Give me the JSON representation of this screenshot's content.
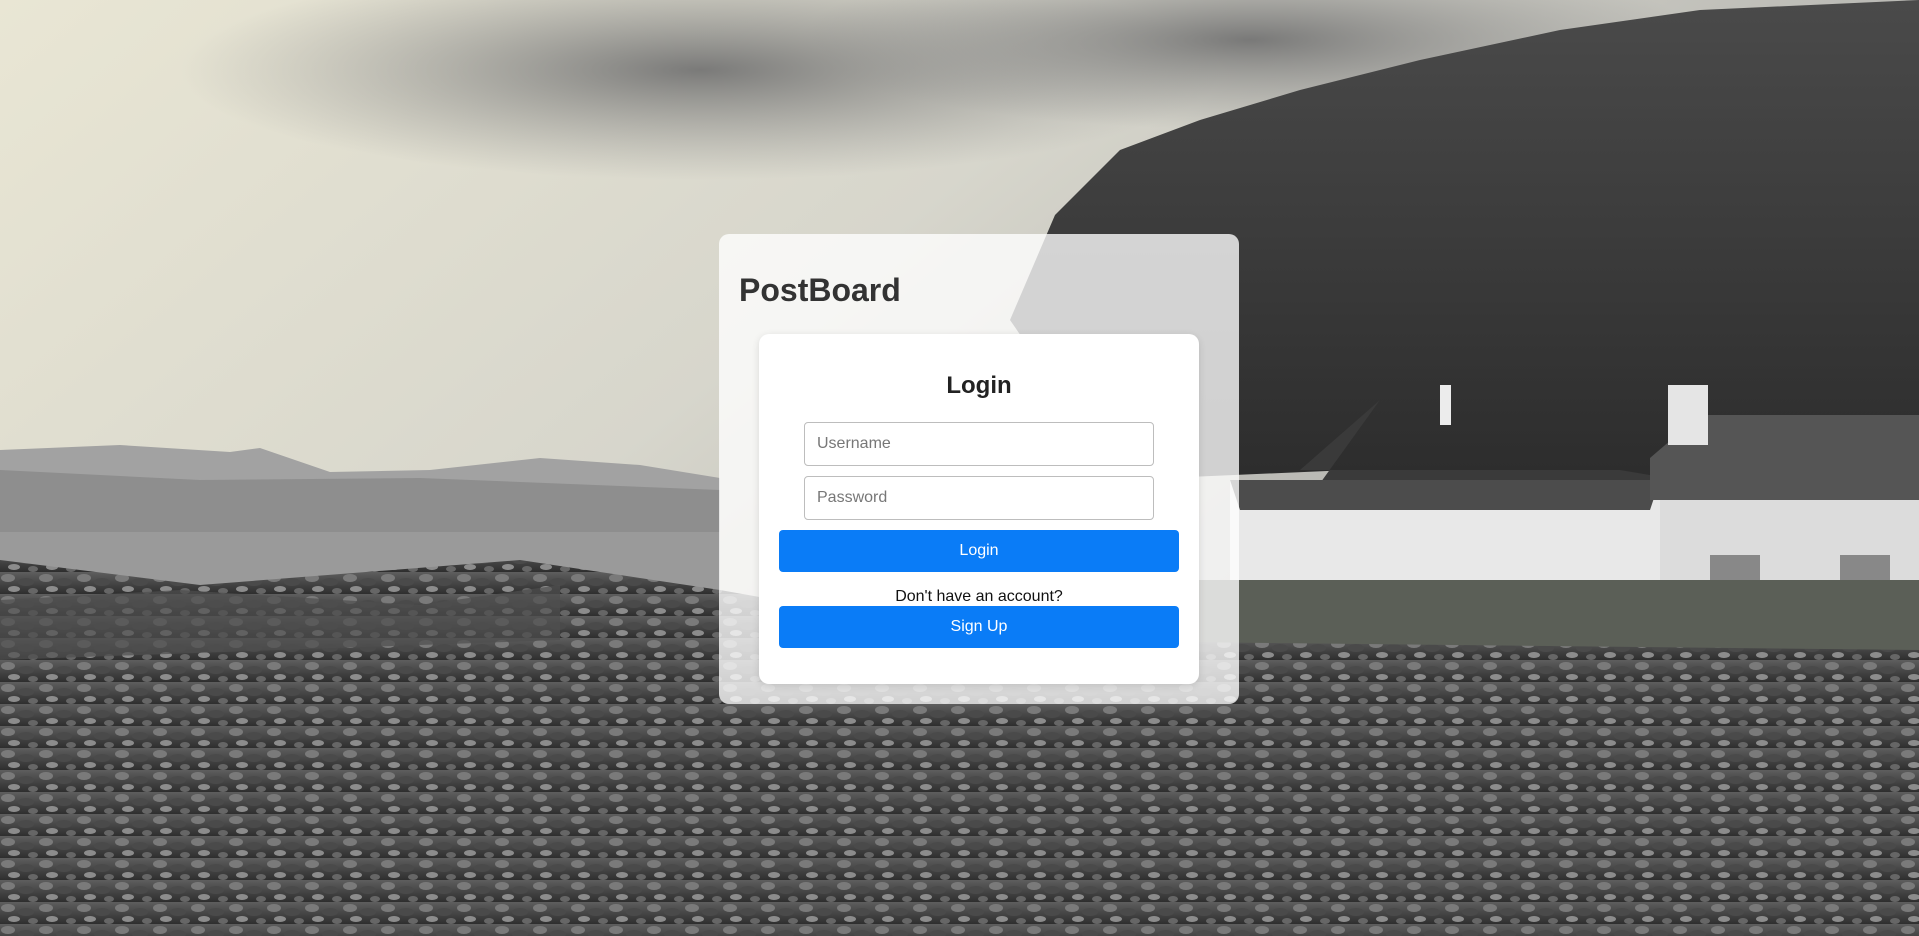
{
  "app": {
    "brand": "PostBoard"
  },
  "login_card": {
    "title": "Login",
    "username_placeholder": "Username",
    "password_placeholder": "Password",
    "login_button": "Login",
    "signup_prompt": "Don't have an account?",
    "signup_button": "Sign Up"
  },
  "colors": {
    "primary": "#0a7cf7",
    "panel": "#ffffff"
  }
}
